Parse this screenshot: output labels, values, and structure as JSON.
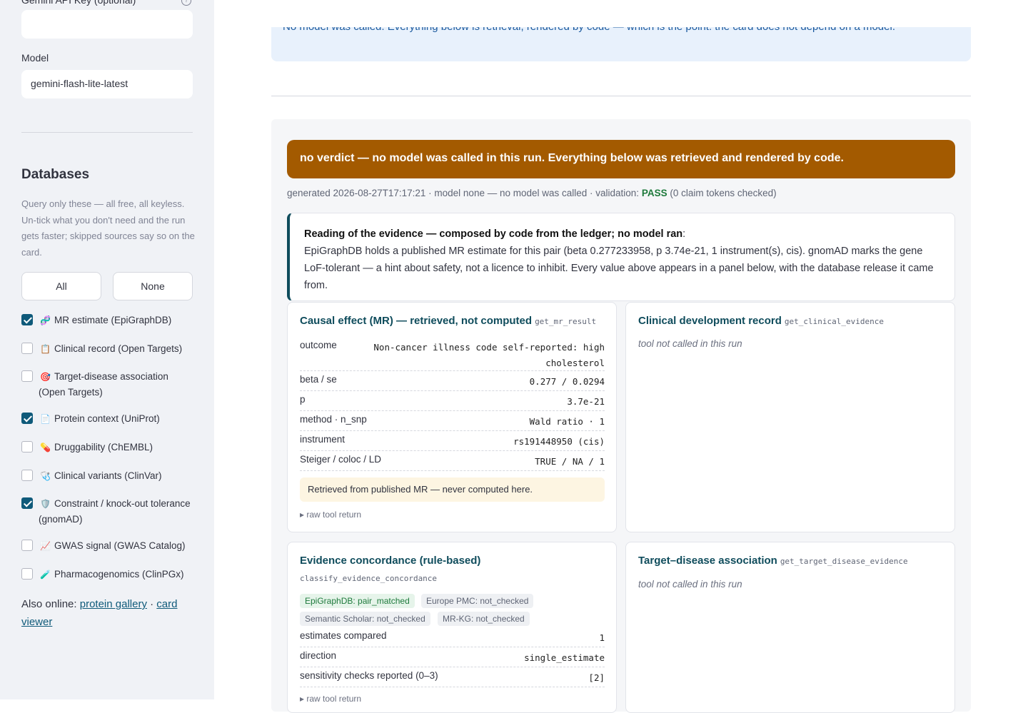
{
  "sidebar": {
    "api_key_label": "Gemini API Key (optional)",
    "api_key_value": "",
    "model_label": "Model",
    "model_value": "gemini-flash-lite-latest",
    "databases_heading": "Databases",
    "databases_desc": "Query only these — all free, all keyless. Un-tick what you don't need and the run gets faster; skipped sources say so on the card.",
    "all_button": "All",
    "none_button": "None",
    "databases": [
      {
        "icon": "🧬",
        "label": "MR estimate (EpiGraphDB)",
        "checked": true
      },
      {
        "icon": "📋",
        "label": "Clinical record (Open Targets)",
        "checked": false
      },
      {
        "icon": "🎯",
        "label": "Target-disease association (Open Targets)",
        "checked": false
      },
      {
        "icon": "📄",
        "label": "Protein context (UniProt)",
        "checked": true
      },
      {
        "icon": "💊",
        "label": "Druggability (ChEMBL)",
        "checked": false
      },
      {
        "icon": "🩺",
        "label": "Clinical variants (ClinVar)",
        "checked": false
      },
      {
        "icon": "🛡️",
        "label": "Constraint / knock-out tolerance (gnomAD)",
        "checked": true
      },
      {
        "icon": "📈",
        "label": "GWAS signal (GWAS Catalog)",
        "checked": false
      },
      {
        "icon": "🧪",
        "label": "Pharmacogenomics (ClinPGx)",
        "checked": false
      }
    ],
    "also_prefix": "Also online:",
    "link_gallery": "protein gallery",
    "separator": "·",
    "link_viewer": "card viewer"
  },
  "main": {
    "info_text": "No model was called. Everything below is retrieval, rendered by code — which is the point: the card does not depend on a model.",
    "verdict": "no verdict — no model was called in this run. Everything below was retrieved and rendered by code.",
    "generated_prefix": "generated 2026-08-27T17:17:21 · model none — no model was called · validation:",
    "validation_status": "PASS",
    "validation_suffix": "(0 claim tokens checked)",
    "reading_title": "Reading of the evidence — composed by code from the ledger; no model ran",
    "reading_body": "EpiGraphDB holds a published MR estimate for this pair (beta 0.277233958, p 3.74e-21, 1 instrument(s), cis). gnomAD marks the gene LoF-tolerant — a hint about safety, not a licence to inhibit. Every value above appears in a panel below, with the database release it came from.",
    "mr_panel": {
      "title": "Causal effect (MR) — retrieved, not computed",
      "tool": "get_mr_result",
      "rows": [
        {
          "k": "outcome",
          "v": "Non-cancer illness code self-reported: high cholesterol"
        },
        {
          "k": "beta / se",
          "v": "0.277 / 0.0294"
        },
        {
          "k": "p",
          "v": "3.7e-21"
        },
        {
          "k": "method · n_snp",
          "v": "Wald ratio · 1"
        },
        {
          "k": "instrument",
          "v": "rs191448950 (cis)"
        },
        {
          "k": "Steiger / coloc / LD",
          "v": "TRUE / NA / 1"
        }
      ],
      "note": "Retrieved from published MR — never computed here.",
      "raw": "▸ raw tool return"
    },
    "clinical_panel": {
      "title": "Clinical development record",
      "tool": "get_clinical_evidence",
      "status": "tool not called in this run"
    },
    "concordance_panel": {
      "title": "Evidence concordance (rule-based)",
      "tool": "classify_evidence_concordance",
      "chips": [
        "EpiGraphDB: pair_matched",
        "Europe PMC: not_checked",
        "Semantic Scholar: not_checked",
        "MR-KG: not_checked"
      ],
      "rows": [
        {
          "k": "estimates compared",
          "v": "1"
        },
        {
          "k": "direction",
          "v": "single_estimate"
        },
        {
          "k": "sensitivity checks reported (0–3)",
          "v": "[2]"
        }
      ],
      "raw": "▸ raw tool return"
    },
    "association_panel": {
      "title": "Target–disease association",
      "tool": "get_target_disease_evidence",
      "status": "tool not called in this run"
    }
  }
}
